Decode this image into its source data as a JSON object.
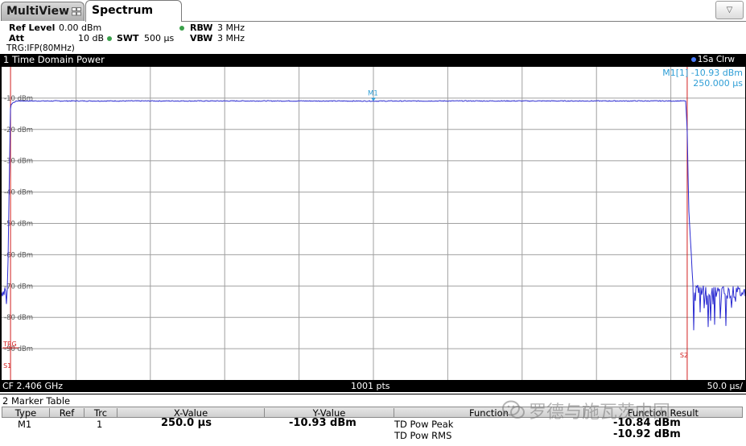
{
  "tabs": {
    "multiview": "MultiView",
    "spectrum": "Spectrum"
  },
  "settings": {
    "ref_level_label": "Ref Level",
    "ref_level_value": "0.00 dBm",
    "att_label": "Att",
    "att_value": "10 dB",
    "swt_label": "SWT",
    "swt_value": "500 µs",
    "rbw_label": "RBW",
    "rbw_value": "3 MHz",
    "vbw_label": "VBW",
    "vbw_value": "3 MHz",
    "trigger": "TRG:IFP(80MHz)"
  },
  "diagram": {
    "title": "1 Time Domain Power",
    "trace_mode": "1Sa Clrw",
    "marker_label": "M1[1]",
    "marker_y": "-10.93 dBm",
    "marker_x": "250.000 µs",
    "marker_tag": "M1",
    "trg_tag": "TRG",
    "s1_tag": "S1",
    "s2_tag": "S2",
    "y_ticks": [
      "-10 dBm",
      "-20 dBm",
      "-30 dBm",
      "-40 dBm",
      "-50 dBm",
      "-60 dBm",
      "-70 dBm",
      "-80 dBm",
      "-90 dBm"
    ],
    "footer_cf": "CF 2.406 GHz",
    "footer_pts": "1001 pts",
    "footer_div": "50.0 µs/"
  },
  "chart_data": {
    "type": "line",
    "x_unit": "µs",
    "y_unit": "dBm",
    "xlim": [
      0,
      500
    ],
    "ylim": [
      -100,
      0
    ],
    "grid": true,
    "series": [
      {
        "x": [
          0,
          4,
          6,
          10,
          100,
          200,
          250,
          300,
          400,
          460,
          461,
          462,
          465,
          480,
          500
        ],
        "y": [
          -72,
          -70,
          -12,
          -10.9,
          -10.9,
          -10.9,
          -10.93,
          -10.9,
          -10.9,
          -10.9,
          -20,
          -45,
          -71,
          -72,
          -72
        ]
      }
    ],
    "markers": [
      {
        "name": "M1",
        "x": 250,
        "y": -10.93
      }
    ],
    "lines": [
      {
        "name": "S1",
        "x": 6
      },
      {
        "name": "S2",
        "x": 461
      }
    ]
  },
  "marker_table": {
    "title": "2 Marker Table",
    "columns": [
      "Type",
      "Ref",
      "Trc",
      "X-Value",
      "Y-Value",
      "Function",
      "Function Result"
    ],
    "row": {
      "type": "M1",
      "ref": "",
      "trc": "1",
      "x_value": "250.0 µs",
      "y_value": "-10.93 dBm"
    },
    "functions": [
      {
        "name": "TD Pow Peak",
        "result": "-10.84 dBm"
      },
      {
        "name": "TD Pow RMS",
        "result": "-10.92 dBm"
      }
    ]
  },
  "watermark": "罗德与施瓦茨中国",
  "colors": {
    "trace": "#2b2bd1",
    "marker": "#2e9ed6",
    "line": "#d22020",
    "grid": "#a0a0a0"
  }
}
